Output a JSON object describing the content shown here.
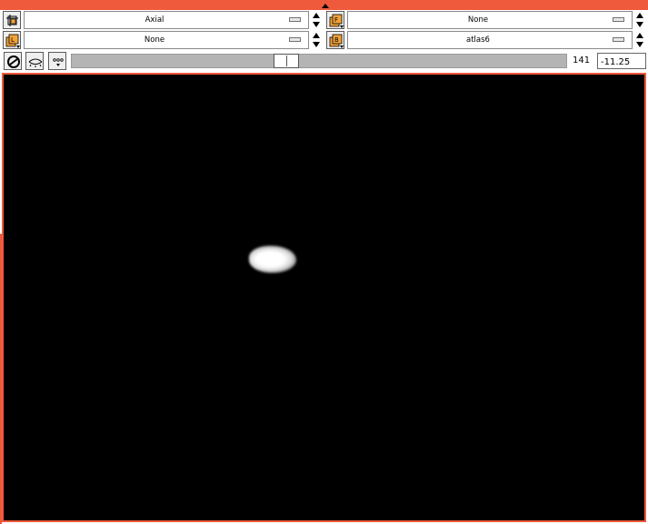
{
  "toolbar": {
    "row1": {
      "left_dropdown": {
        "value": "Axial"
      },
      "right_dropdown": {
        "value": "None"
      },
      "left_icon": "crop-frame-icon",
      "right_icon": "foreground-layer-icon",
      "right_icon_letter": "F"
    },
    "row2": {
      "left_dropdown": {
        "value": "None"
      },
      "right_dropdown": {
        "value": "atlas6"
      },
      "left_icon": "label-layer-icon",
      "left_icon_letter": "L",
      "right_icon": "background-layer-icon",
      "right_icon_letter": "B"
    },
    "row3": {
      "icons": [
        "link-icon",
        "eye-visibility-icon",
        "more-options-icon"
      ],
      "slider_position": 0.43,
      "slice_number": "141",
      "slice_position": "-11.25"
    }
  },
  "colors": {
    "frame_accent": "#f05a3c",
    "icon_accent": "#f2a33a",
    "viewer_background": "#000000"
  }
}
